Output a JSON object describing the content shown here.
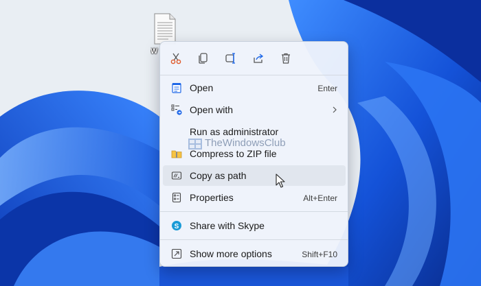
{
  "desktop": {
    "file_label": "W",
    "accent_blue": "#1f68e8",
    "deep_blue": "#0b2f9e"
  },
  "toolbar": {
    "actions": [
      {
        "name": "cut",
        "icon": "scissors-icon",
        "color": "#e05a2b"
      },
      {
        "name": "copy",
        "icon": "copy-icon"
      },
      {
        "name": "rename",
        "icon": "rename-icon"
      },
      {
        "name": "share",
        "icon": "share-icon"
      },
      {
        "name": "delete",
        "icon": "trash-icon"
      }
    ]
  },
  "menu": {
    "items": [
      {
        "label": "Open",
        "shortcut": "Enter",
        "icon": "notepad-icon"
      },
      {
        "label": "Open with",
        "submenu": true,
        "icon": "open-with-icon"
      },
      {
        "label": "Run as administrator",
        "icon": "shield-icon"
      },
      {
        "label": "Compress to ZIP file",
        "icon": "zip-folder-icon"
      },
      {
        "label": "Copy as path",
        "icon": "copy-path-icon",
        "hovered": true
      },
      {
        "label": "Properties",
        "shortcut": "Alt+Enter",
        "icon": "properties-icon"
      },
      {
        "label": "Share with Skype",
        "icon": "skype-icon"
      },
      {
        "label": "Show more options",
        "shortcut": "Shift+F10",
        "icon": "more-options-icon"
      }
    ]
  },
  "watermark": {
    "text": "TheWindowsClub"
  }
}
